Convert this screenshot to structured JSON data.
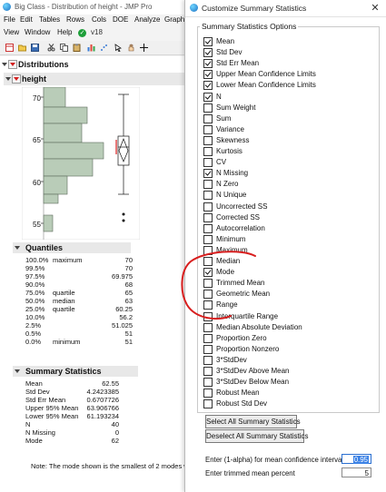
{
  "bg_window": {
    "title": "Big Class - Distribution of height - JMP Pro",
    "menus": [
      "File",
      "Edit",
      "Tables",
      "Rows",
      "Cols",
      "DOE",
      "Analyze",
      "Graph"
    ],
    "menus2": [
      "View",
      "Window",
      "Help"
    ],
    "version": "v18",
    "distributions_label": "Distributions",
    "height_label": "height",
    "y_ticks": [
      "70",
      "65",
      "60",
      "55",
      "50"
    ],
    "quantiles_label": "Quantiles",
    "quantiles": [
      {
        "pct": "100.0%",
        "name": "maximum",
        "val": "70"
      },
      {
        "pct": "99.5%",
        "name": "",
        "val": "70"
      },
      {
        "pct": "97.5%",
        "name": "",
        "val": "69.975"
      },
      {
        "pct": "90.0%",
        "name": "",
        "val": "68"
      },
      {
        "pct": "75.0%",
        "name": "quartile",
        "val": "65"
      },
      {
        "pct": "50.0%",
        "name": "median",
        "val": "63"
      },
      {
        "pct": "25.0%",
        "name": "quartile",
        "val": "60.25"
      },
      {
        "pct": "10.0%",
        "name": "",
        "val": "56.2"
      },
      {
        "pct": "2.5%",
        "name": "",
        "val": "51.025"
      },
      {
        "pct": "0.5%",
        "name": "",
        "val": "51"
      },
      {
        "pct": "0.0%",
        "name": "minimum",
        "val": "51"
      }
    ],
    "summary_label": "Summary Statistics",
    "summary": [
      {
        "name": "Mean",
        "val": "62.55"
      },
      {
        "name": "Std Dev",
        "val": "4.2423385"
      },
      {
        "name": "Std Err Mean",
        "val": "0.6707726"
      },
      {
        "name": "Upper 95% Mean",
        "val": "63.906766"
      },
      {
        "name": "Lower 95% Mean",
        "val": "61.193234"
      },
      {
        "name": "N",
        "val": "40"
      },
      {
        "name": "N Missing",
        "val": "0"
      },
      {
        "name": "Mode",
        "val": "62"
      }
    ],
    "note": "Note: The mode shown is the smallest of 2 modes w"
  },
  "dialog": {
    "title": "Customize Summary Statistics",
    "group_label": "Summary Statistics Options",
    "options": [
      {
        "label": "Mean",
        "checked": true
      },
      {
        "label": "Std Dev",
        "checked": true
      },
      {
        "label": "Std Err Mean",
        "checked": true
      },
      {
        "label": "Upper Mean Confidence Limits",
        "checked": true
      },
      {
        "label": "Lower Mean Confidence Limits",
        "checked": true
      },
      {
        "label": "N",
        "checked": true
      },
      {
        "label": "Sum Weight",
        "checked": false
      },
      {
        "label": "Sum",
        "checked": false
      },
      {
        "label": "Variance",
        "checked": false
      },
      {
        "label": "Skewness",
        "checked": false
      },
      {
        "label": "Kurtosis",
        "checked": false
      },
      {
        "label": "CV",
        "checked": false
      },
      {
        "label": "N Missing",
        "checked": true
      },
      {
        "label": "N Zero",
        "checked": false
      },
      {
        "label": "N Unique",
        "checked": false
      },
      {
        "label": "Uncorrected SS",
        "checked": false
      },
      {
        "label": "Corrected SS",
        "checked": false
      },
      {
        "label": "Autocorrelation",
        "checked": false
      },
      {
        "label": "Minimum",
        "checked": false
      },
      {
        "label": "Maximum",
        "checked": false
      },
      {
        "label": "Median",
        "checked": false
      },
      {
        "label": "Mode",
        "checked": true
      },
      {
        "label": "Trimmed Mean",
        "checked": false
      },
      {
        "label": "Geometric Mean",
        "checked": false
      },
      {
        "label": "Range",
        "checked": false
      },
      {
        "label": "Interquartile Range",
        "checked": false
      },
      {
        "label": "Median Absolute Deviation",
        "checked": false
      },
      {
        "label": "Proportion Zero",
        "checked": false
      },
      {
        "label": "Proportion Nonzero",
        "checked": false
      },
      {
        "label": "3*StdDev",
        "checked": false
      },
      {
        "label": "3*StdDev Above Mean",
        "checked": false
      },
      {
        "label": "3*StdDev Below Mean",
        "checked": false
      },
      {
        "label": "Robust Mean",
        "checked": false
      },
      {
        "label": "Robust Std Dev",
        "checked": false
      }
    ],
    "select_all_label": "Select All Summary Statistics",
    "deselect_all_label": "Deselect All Summary Statistics",
    "alpha_label": "Enter (1-alpha) for mean confidence interval",
    "alpha_value": "0.95",
    "trim_label": "Enter trimmed mean percent",
    "trim_value": "5"
  },
  "colors": {
    "histogram_fill": "#b9ccb8",
    "annotation_red": "#d81e1e",
    "accent_blue": "#3b82e6"
  }
}
